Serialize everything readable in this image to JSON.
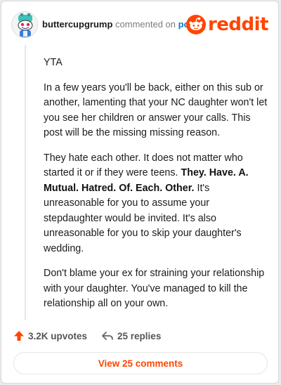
{
  "comment": {
    "username": "buttercupgrump",
    "verb": "commented on",
    "target": "post",
    "paragraphs": [
      {
        "text": "YTA"
      },
      {
        "text": "In a few years you'll be back, either on this sub or another, lamenting that your NC daughter won't let you see her children or answer your calls. This post will be the missing missing reason."
      },
      {
        "before": "They hate each other. It does not matter who started it or if they were teens. ",
        "bold": "They. Have. A. Mutual. Hatred. Of. Each. Other.",
        "after": " It's unreasonable for you to assume your stepdaughter would be invited. It's also unreasonable for you to skip your daughter's wedding."
      },
      {
        "text": "Don't blame your ex for straining your relationship with your daughter. You've managed to kill the relationship all on your own."
      }
    ]
  },
  "brand": {
    "wordmark": "reddit",
    "color": "#ff4500",
    "icon": "reddit-alien-icon"
  },
  "actions": {
    "upvotes": "3.2K upvotes",
    "replies": "25 replies",
    "upvote_icon": "arrow-up-icon",
    "reply_icon": "reply-arrow-icon"
  },
  "footer": {
    "view_comments_label": "View 25 comments"
  }
}
